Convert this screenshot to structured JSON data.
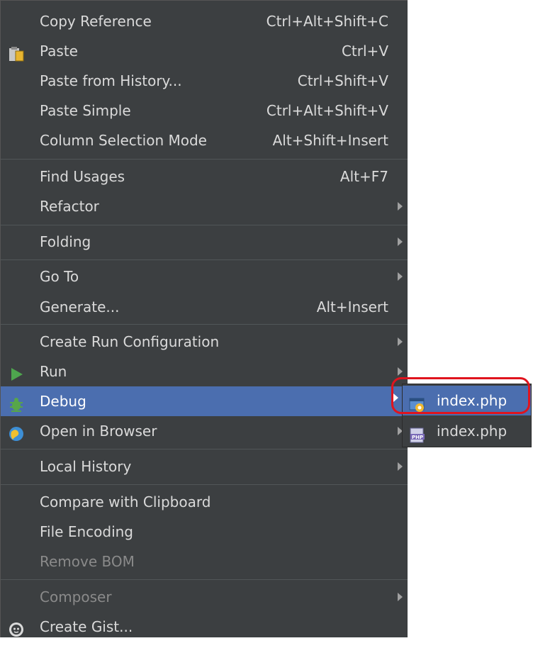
{
  "menu": {
    "items": [
      {
        "label": "Copy Reference",
        "shortcut": "Ctrl+Alt+Shift+C"
      },
      {
        "label": "Paste",
        "shortcut": "Ctrl+V",
        "icon": "clipboard-icon"
      },
      {
        "label": "Paste from History...",
        "shortcut": "Ctrl+Shift+V"
      },
      {
        "label": "Paste Simple",
        "shortcut": "Ctrl+Alt+Shift+V"
      },
      {
        "label": "Column Selection Mode",
        "shortcut": "Alt+Shift+Insert"
      },
      {
        "label": "Find Usages",
        "shortcut": "Alt+F7"
      },
      {
        "label": "Refactor",
        "submenu": true
      },
      {
        "label": "Folding",
        "submenu": true
      },
      {
        "label": "Go To",
        "submenu": true
      },
      {
        "label": "Generate...",
        "shortcut": "Alt+Insert"
      },
      {
        "label": "Create Run Configuration",
        "submenu": true
      },
      {
        "label": "Run",
        "submenu": true,
        "icon": "run-icon"
      },
      {
        "label": "Debug",
        "submenu": true,
        "icon": "debug-icon",
        "selected": true
      },
      {
        "label": "Open in Browser",
        "submenu": true,
        "icon": "browser-icon"
      },
      {
        "label": "Local History",
        "submenu": true
      },
      {
        "label": "Compare with Clipboard"
      },
      {
        "label": "File Encoding"
      },
      {
        "label": "Remove BOM",
        "disabled": true
      },
      {
        "label": "Composer",
        "submenu": true,
        "disabled": true
      },
      {
        "label": "Create Gist...",
        "icon": "github-icon"
      }
    ]
  },
  "submenu": {
    "items": [
      {
        "label": "index.php",
        "icon": "debug-config-icon",
        "selected": true
      },
      {
        "label": "index.php",
        "icon": "php-file-icon"
      }
    ]
  },
  "colors": {
    "menu_bg": "#3c3f41",
    "selection": "#4b6eaf",
    "text": "#dadada",
    "disabled_text": "#8a8a8a",
    "highlight_ring": "#e0141e"
  }
}
